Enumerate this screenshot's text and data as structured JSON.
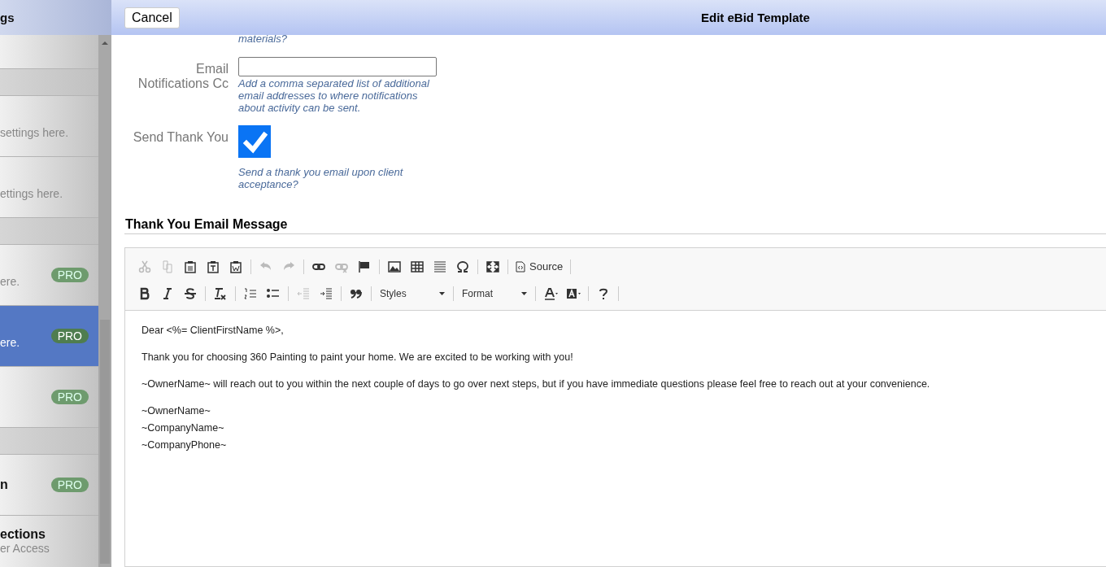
{
  "sidebar": {
    "title": "gs",
    "items": [
      {
        "kind": "item",
        "selected": false
      },
      {
        "kind": "section"
      },
      {
        "kind": "item",
        "subtitle": "settings here.",
        "selected": false
      },
      {
        "kind": "item",
        "subtitle": "ettings here.",
        "selected": false
      },
      {
        "kind": "section"
      },
      {
        "kind": "item",
        "subtitle": "ere.",
        "badge": "PRO",
        "selected": false
      },
      {
        "kind": "item",
        "subtitle": "ere.",
        "badge": "PRO",
        "selected": true
      },
      {
        "kind": "item",
        "badge": "PRO",
        "selected": false
      },
      {
        "kind": "section"
      },
      {
        "kind": "item",
        "title": "n",
        "badge": "PRO",
        "selected": false
      },
      {
        "kind": "item",
        "title": "ections",
        "subtitle": "er Access",
        "selected": false
      }
    ]
  },
  "header": {
    "cancel": "Cancel",
    "title": "Edit eBid Template"
  },
  "form": {
    "top_hint": "materials?",
    "fields": [
      {
        "kind": "text",
        "label": "Email Notifications Cc",
        "hint": "Add a comma separated list of additional email addresses to where notifications about activity can be sent."
      },
      {
        "kind": "checkbox",
        "label": "Send Thank You",
        "checked": true,
        "hint": "Send a thank you email upon client acceptance?"
      }
    ]
  },
  "section_title": "Thank You Email Message",
  "editor": {
    "toolbar": [
      [
        [
          {
            "kind": "cut",
            "disabled": true
          },
          {
            "kind": "copy",
            "disabled": true
          },
          {
            "kind": "paste",
            "disabled": false
          },
          {
            "kind": "paste-text",
            "disabled": false
          },
          {
            "kind": "paste-word",
            "disabled": false
          }
        ],
        [
          {
            "kind": "undo",
            "disabled": true
          },
          {
            "kind": "redo",
            "disabled": true
          }
        ],
        [
          {
            "kind": "link",
            "disabled": false
          },
          {
            "kind": "unlink",
            "disabled": true
          },
          {
            "kind": "flag",
            "disabled": false
          }
        ],
        [
          {
            "kind": "image",
            "disabled": false
          },
          {
            "kind": "table",
            "disabled": false
          },
          {
            "kind": "lines",
            "disabled": false
          },
          {
            "kind": "omega",
            "disabled": false
          }
        ],
        [
          {
            "kind": "maximize",
            "disabled": false
          }
        ],
        [
          {
            "kind": "source",
            "label": "Source",
            "disabled": false
          }
        ]
      ],
      [
        [
          {
            "kind": "bold",
            "disabled": false
          },
          {
            "kind": "italic",
            "disabled": false
          },
          {
            "kind": "strike",
            "disabled": false
          }
        ],
        [
          {
            "kind": "clear",
            "disabled": false
          }
        ],
        [
          {
            "kind": "ol",
            "disabled": false
          },
          {
            "kind": "ul",
            "disabled": false
          }
        ],
        [
          {
            "kind": "outdent",
            "disabled": true
          },
          {
            "kind": "indent",
            "disabled": false
          }
        ],
        [
          {
            "kind": "quote",
            "disabled": false
          }
        ],
        [
          {
            "kind": "combo",
            "label": "Styles"
          }
        ],
        [
          {
            "kind": "combo",
            "label": "Format"
          }
        ],
        [
          {
            "kind": "text-color",
            "disabled": false
          },
          {
            "kind": "bg-color",
            "disabled": false
          }
        ],
        [
          {
            "kind": "help",
            "disabled": false
          }
        ]
      ]
    ],
    "paragraphs": [
      [
        "Dear <%= ClientFirstName %>,"
      ],
      [
        "Thank you for choosing 360 Painting to paint your home. We are excited to be working with you!"
      ],
      [
        "~OwnerName~ will reach out to you within the next couple of days to go over next steps, but if you have immediate questions please feel free to reach out at your convenience."
      ],
      [
        "~OwnerName~",
        "~CompanyName~",
        "~CompanyPhone~"
      ]
    ]
  }
}
